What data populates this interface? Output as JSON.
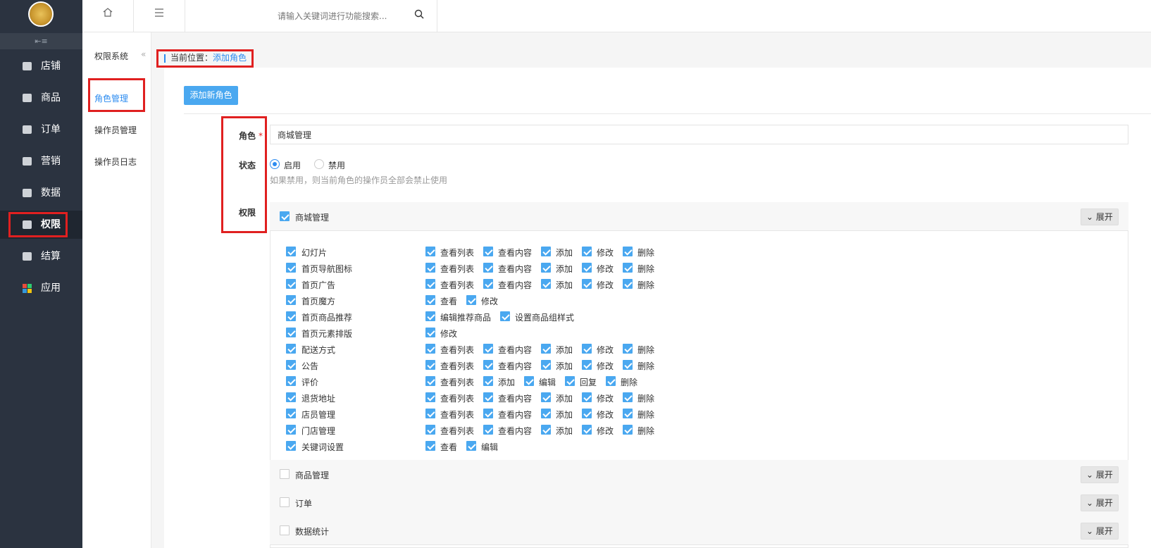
{
  "sidebar": {
    "collapse_icon": "collapse-icon",
    "items": [
      {
        "label": "店铺",
        "icon": "shop-icon"
      },
      {
        "label": "商品",
        "icon": "goods-icon"
      },
      {
        "label": "订单",
        "icon": "order-icon"
      },
      {
        "label": "营销",
        "icon": "gift-icon"
      },
      {
        "label": "数据",
        "icon": "chart-icon"
      },
      {
        "label": "权限",
        "icon": "user-lock-icon"
      },
      {
        "label": "结算",
        "icon": "money-bag-icon"
      },
      {
        "label": "应用",
        "icon": "apps-icon"
      }
    ],
    "active_index": 5
  },
  "topbar": {
    "search_placeholder": "请输入关键词进行功能搜索..."
  },
  "subnav": {
    "title": "权限系统",
    "items": [
      "角色管理",
      "操作员管理",
      "操作员日志"
    ],
    "active_index": 0
  },
  "breadcrumb": {
    "prefix": "当前位置：",
    "current": "添加角色"
  },
  "actions": {
    "add_role": "添加新角色"
  },
  "form": {
    "role_label": "角色",
    "role_required": "*",
    "role_value": "商城管理",
    "status_label": "状态",
    "status_options": [
      "启用",
      "禁用"
    ],
    "status_selected": 0,
    "status_hint": "如果禁用，则当前角色的操作员全部会禁止使用",
    "perm_label": "权限"
  },
  "permissions": {
    "expand_label": "展开",
    "groups": [
      {
        "name": "商城管理",
        "checked": true
      },
      {
        "name": "商品管理",
        "checked": false
      },
      {
        "name": "订单",
        "checked": false
      },
      {
        "name": "数据统计",
        "checked": false
      }
    ],
    "rows": [
      {
        "name": "幻灯片",
        "perms": [
          "查看列表",
          "查看内容",
          "添加",
          "修改",
          "删除"
        ]
      },
      {
        "name": "首页导航图标",
        "perms": [
          "查看列表",
          "查看内容",
          "添加",
          "修改",
          "删除"
        ]
      },
      {
        "name": "首页广告",
        "perms": [
          "查看列表",
          "查看内容",
          "添加",
          "修改",
          "删除"
        ]
      },
      {
        "name": "首页魔方",
        "perms": [
          "查看",
          "修改"
        ]
      },
      {
        "name": "首页商品推荐",
        "perms": [
          "编辑推荐商品",
          "设置商品组样式"
        ]
      },
      {
        "name": "首页元素排版",
        "perms": [
          "修改"
        ]
      },
      {
        "name": "配送方式",
        "perms": [
          "查看列表",
          "查看内容",
          "添加",
          "修改",
          "删除"
        ]
      },
      {
        "name": "公告",
        "perms": [
          "查看列表",
          "查看内容",
          "添加",
          "修改",
          "删除"
        ]
      },
      {
        "name": "评价",
        "perms": [
          "查看列表",
          "添加",
          "编辑",
          "回复",
          "删除"
        ]
      },
      {
        "name": "退货地址",
        "perms": [
          "查看列表",
          "查看内容",
          "添加",
          "修改",
          "删除"
        ]
      },
      {
        "name": "店员管理",
        "perms": [
          "查看列表",
          "查看内容",
          "添加",
          "修改",
          "删除"
        ]
      },
      {
        "name": "门店管理",
        "perms": [
          "查看列表",
          "查看内容",
          "添加",
          "修改",
          "删除"
        ]
      },
      {
        "name": "关键词设置",
        "perms": [
          "查看",
          "编辑"
        ]
      }
    ]
  },
  "colors": {
    "sidebar_bg": "#2b3340",
    "accent": "#2d8cf0",
    "button": "#4aa8f0",
    "highlight_box": "#e02020"
  }
}
